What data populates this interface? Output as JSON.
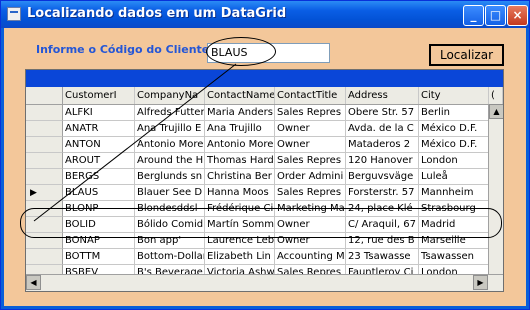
{
  "window": {
    "title": "Localizando dados em um DataGrid",
    "controls": {
      "minimize": "_",
      "maximize": "□",
      "close": "×"
    }
  },
  "search": {
    "label": "Informe o Código do Cliente",
    "value": "BLAUS"
  },
  "button": {
    "label": "Localizar"
  },
  "grid": {
    "columns": [
      "CustomerI",
      "CompanyNa",
      "ContactName",
      "ContactTitle",
      "Address",
      "City",
      "("
    ],
    "rows": [
      [
        "ALFKI",
        "Alfreds Futter",
        "Maria Anders",
        "Sales Repres",
        "Obere Str. 57",
        "Berlin",
        "("
      ],
      [
        "ANATR",
        "Ana Trujillo E",
        "Ana Trujillo",
        "Owner",
        "Avda. de la C",
        "México D.F.",
        "("
      ],
      [
        "ANTON",
        "Antonio More",
        "Antonio More",
        "Owner",
        "Mataderos  2",
        "México D.F.",
        "("
      ],
      [
        "AROUT",
        "Around the H",
        "Thomas Hard",
        "Sales Repres",
        "120 Hanover",
        "London",
        "("
      ],
      [
        "BERGS",
        "Berglunds sn",
        "Christina Ber",
        "Order Admini",
        "Berguvsväge",
        "Luleå",
        "("
      ],
      [
        "BLAUS",
        "Blauer See D",
        "Hanna Moos",
        "Sales Repres",
        "Forsterstr. 57",
        "Mannheim",
        "("
      ],
      [
        "BLONP",
        "Blondesddsl",
        "Frédérique Ci",
        "Marketing Ma",
        "24, place Klé",
        "Strasbourg",
        "("
      ],
      [
        "BOLID",
        "Bólido Comid",
        "Martín Somm",
        "Owner",
        "C/ Araquil, 67",
        "Madrid",
        "("
      ],
      [
        "BONAP",
        "Bon app'",
        "Laurence Leb",
        "Owner",
        "12, rue des B",
        "Marseille",
        "("
      ],
      [
        "BOTTM",
        "Bottom-Dollar",
        "Elizabeth Lin",
        "Accounting M",
        "23 Tsawasse",
        "Tsawassen",
        "E"
      ],
      [
        "BSBEV",
        "B's Beverage",
        "Victoria Ashw",
        "Sales Repres",
        "Fauntleroy Ci",
        "London",
        "("
      ]
    ],
    "current_row_marker": "▶",
    "selected_index": 5
  },
  "colors": {
    "client_bg": "#f3c79a",
    "label": "#2456d6",
    "caption": "#0a46d8"
  }
}
